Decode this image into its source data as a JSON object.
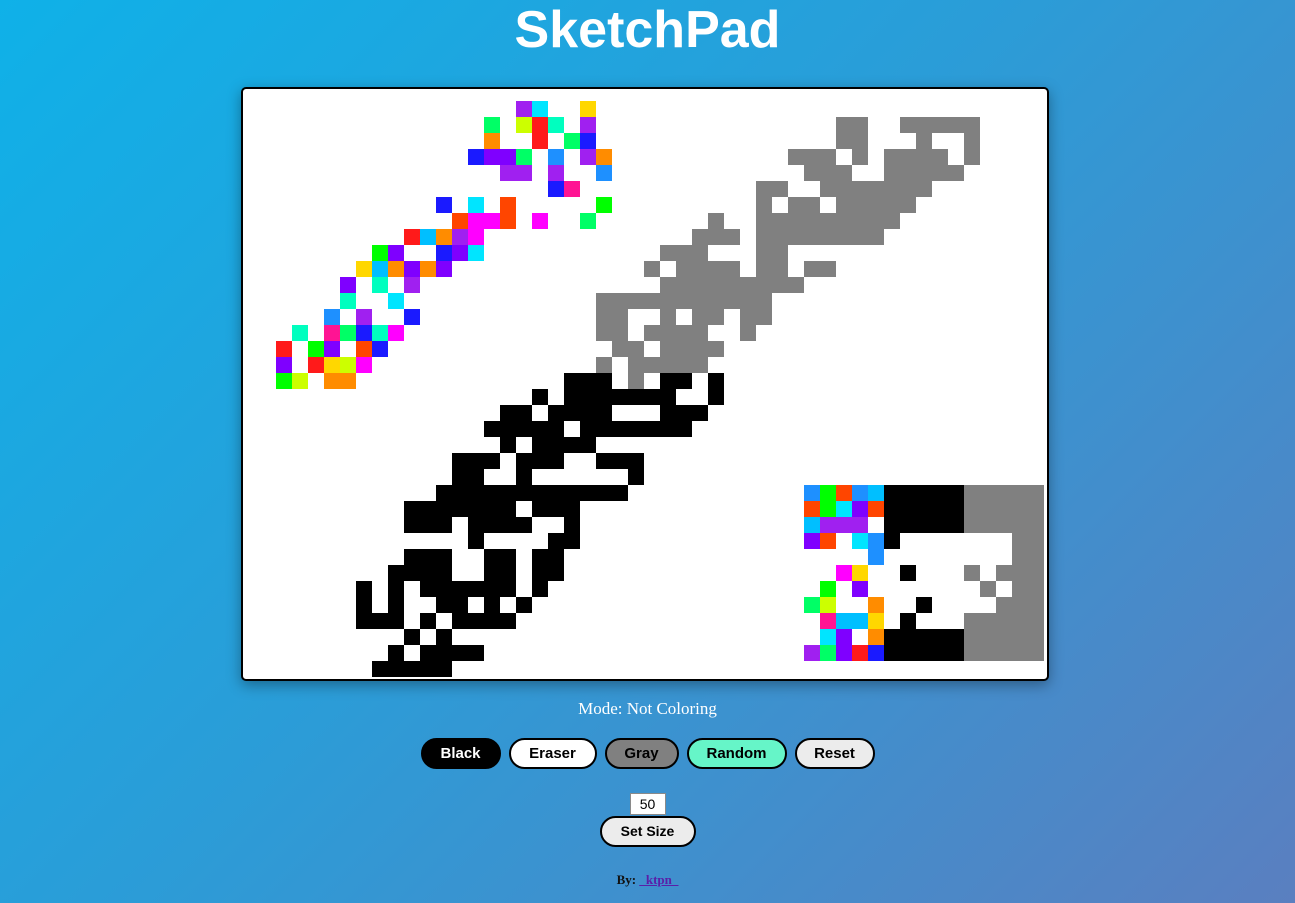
{
  "app": {
    "title": "SketchPad"
  },
  "status": {
    "mode_text": "Mode: Not Coloring"
  },
  "tools": {
    "black": "Black",
    "eraser": "Eraser",
    "gray": "Gray",
    "random": "Random",
    "reset": "Reset"
  },
  "grid_size": {
    "value": "50",
    "button": "Set Size"
  },
  "credit": {
    "prefix": "By:",
    "author": "_ktpn_"
  },
  "colors": {
    "black": "#000000",
    "gray": "#808080",
    "eraser": "#ffffff",
    "random_button": "#66f5c8",
    "reset_button": "#ececec",
    "link": "#5a1fa8",
    "palette": [
      "#ff00ff",
      "#00e5ff",
      "#ff1a1a",
      "#00ff66",
      "#ffd700",
      "#1a1aff",
      "#ff8c00",
      "#a020f0",
      "#ccff00",
      "#00bfff",
      "#ff1493",
      "#00ff00",
      "#1e90ff",
      "#ff4500",
      "#7f00ff",
      "#00ffbf"
    ]
  }
}
